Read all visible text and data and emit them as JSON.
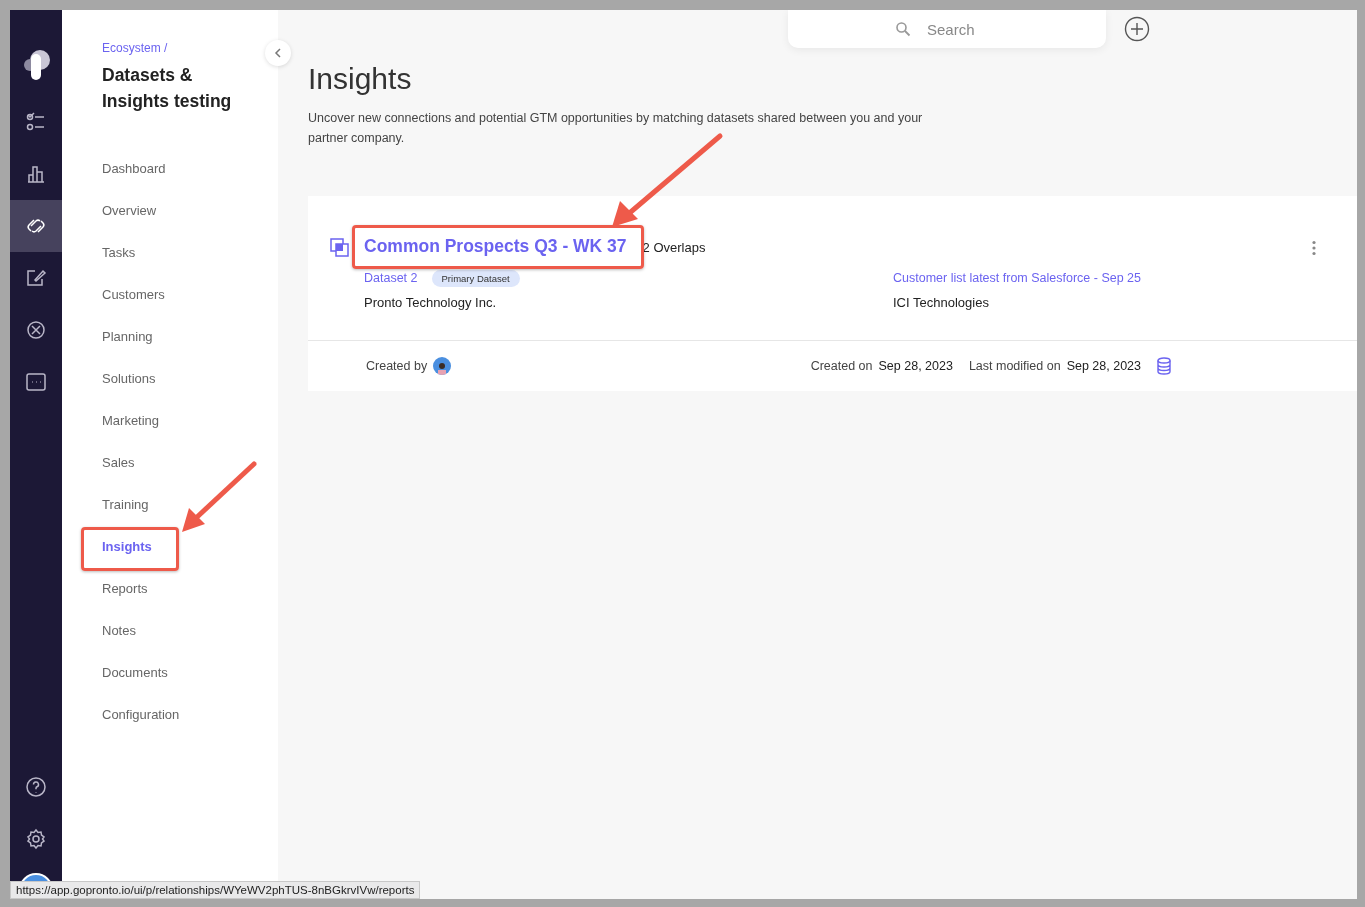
{
  "rail": [
    {
      "kind": "checklist",
      "selected": false
    },
    {
      "kind": "chart",
      "selected": false
    },
    {
      "kind": "link",
      "selected": true
    },
    {
      "kind": "edit",
      "selected": false
    },
    {
      "kind": "cancel",
      "selected": false
    },
    {
      "kind": "more",
      "selected": false
    }
  ],
  "rail_bottom": [
    {
      "kind": "help"
    },
    {
      "kind": "settings"
    }
  ],
  "sidebar": {
    "breadcrumb": "Ecosystem /",
    "title": "Datasets & Insights testing",
    "items": [
      {
        "label": "Dashboard",
        "selected": false
      },
      {
        "label": "Overview",
        "selected": false
      },
      {
        "label": "Tasks",
        "selected": false
      },
      {
        "label": "Customers",
        "selected": false
      },
      {
        "label": "Planning",
        "selected": false
      },
      {
        "label": "Solutions",
        "selected": false
      },
      {
        "label": "Marketing",
        "selected": false
      },
      {
        "label": "Sales",
        "selected": false
      },
      {
        "label": "Training",
        "selected": false
      },
      {
        "label": "Insights",
        "selected": true
      },
      {
        "label": "Reports",
        "selected": false
      },
      {
        "label": "Notes",
        "selected": false
      },
      {
        "label": "Documents",
        "selected": false
      },
      {
        "label": "Configuration",
        "selected": false
      }
    ]
  },
  "search": {
    "placeholder": "Search"
  },
  "page": {
    "title": "Insights",
    "description": "Uncover new connections and potential GTM opportunities by matching datasets shared between you and your partner company."
  },
  "card": {
    "title": "Common Prospects Q3 - WK 37",
    "overlaps": "2 Overlaps",
    "left": {
      "dataset": "Dataset 2",
      "badge": "Primary Dataset",
      "company": "Pronto Technology Inc."
    },
    "right": {
      "dataset": "Customer list latest from Salesforce - Sep 25",
      "company": "ICI Technologies"
    },
    "created_by_label": "Created by",
    "created_on_label": "Created on",
    "created_on": "Sep 28, 2023",
    "modified_label": "Last modified on",
    "modified_on": "Sep 28, 2023"
  },
  "status_url": "https://app.gopronto.io/ui/p/relationships/WYeWV2phTUS-8nBGkrvIVw/reports"
}
